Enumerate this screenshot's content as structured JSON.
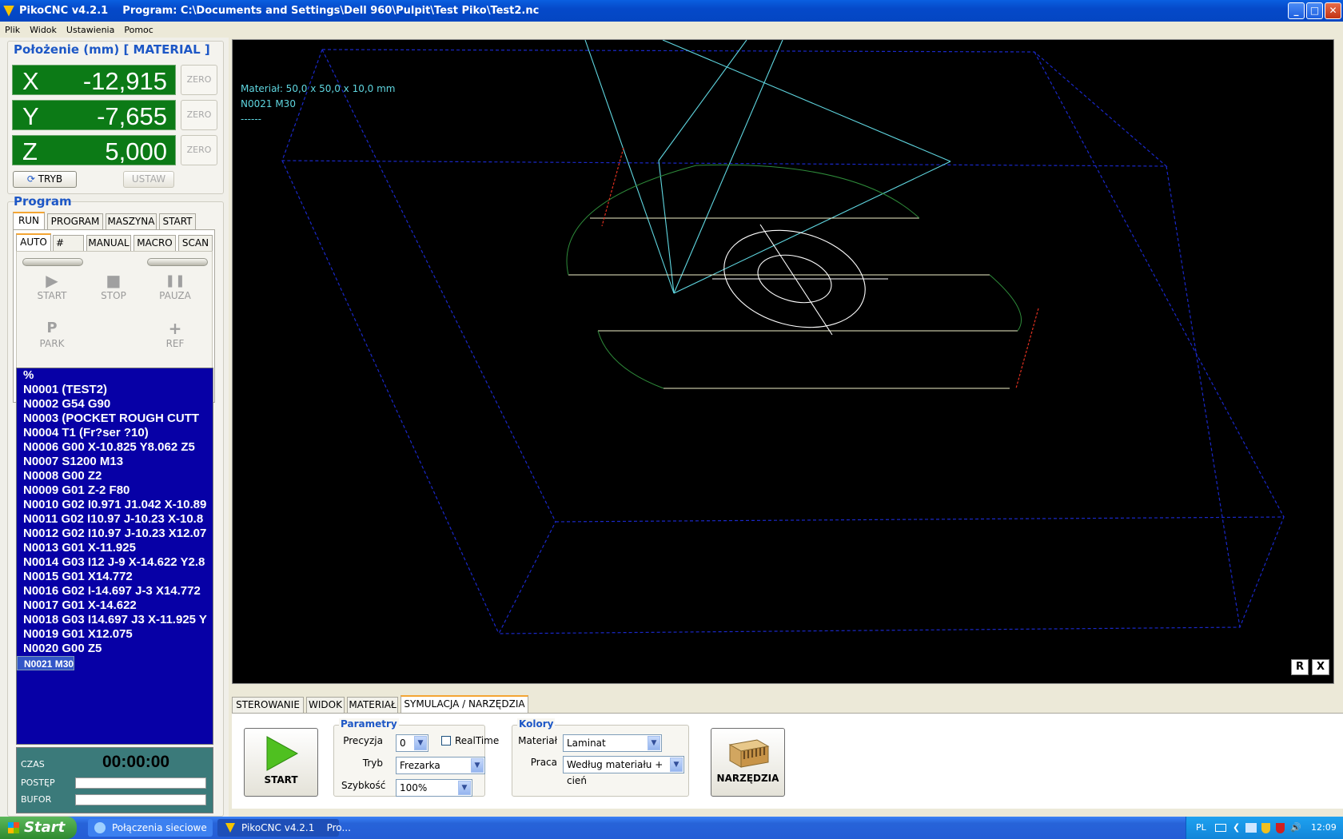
{
  "window": {
    "title": "PikoCNC v4.2.1    Program: C:\\Documents and Settings\\Dell 960\\Pulpit\\Test Piko\\Test2.nc",
    "min_glyph": "_",
    "max_glyph": "□",
    "close_glyph": "✕"
  },
  "menu": [
    "Plik",
    "Widok",
    "Ustawienia",
    "Pomoc"
  ],
  "position": {
    "title": "Położenie (mm) [ MATERIAL ]",
    "axes": [
      {
        "name": "X",
        "value": "-12,915",
        "zero": "ZERO"
      },
      {
        "name": "Y",
        "value": "-7,655",
        "zero": "ZERO"
      },
      {
        "name": "Z",
        "value": "5,000",
        "zero": "ZERO"
      }
    ],
    "mode_button": "TRYB",
    "set_button": "USTAW"
  },
  "program": {
    "title": "Program",
    "tabs": [
      "RUN",
      "PROGRAM",
      "MASZYNA",
      "START"
    ],
    "subtabs": [
      "AUTO",
      "#",
      "MANUAL",
      "MACRO",
      "SCAN"
    ],
    "controls": [
      {
        "label": "START",
        "icon": "play-icon",
        "glyph": "▶"
      },
      {
        "label": "STOP",
        "icon": "stop-icon",
        "glyph": "■"
      },
      {
        "label": "PAUZA",
        "icon": "pause-icon",
        "glyph": "❚❚"
      },
      {
        "label": "PARK",
        "icon": "park-icon",
        "glyph": "P"
      },
      {
        "label": "REF",
        "icon": "plus-icon",
        "glyph": "+"
      }
    ],
    "code_lines": [
      "%",
      "N0001 (TEST2)",
      "N0002 G54 G90",
      "N0003 (POCKET ROUGH CUTT",
      "N0004 T1 (Fr?ser ?10)",
      "N0006 G00 X-10.825 Y8.062 Z5",
      "N0007 S1200 M13",
      "N0008 G00 Z2",
      "N0009 G01 Z-2 F80",
      "N0010 G02 I0.971 J1.042 X-10.89",
      "N0011 G02 I10.97 J-10.23 X-10.8",
      "N0012 G02 I10.97 J-10.23 X12.07",
      "N0013 G01 X-11.925",
      "N0014 G03 I12 J-9 X-14.622 Y2.8",
      "N0015 G01 X14.772",
      "N0016 G02 I-14.697 J-3 X14.772",
      "N0017 G01 X-14.622",
      "N0018 G03 I14.697 J3 X-11.925 Y",
      "N0019 G01 X12.075",
      "N0020 G00 Z5",
      "N0021 M30"
    ],
    "selected_line": 20
  },
  "stats": {
    "time_label": "CZAS",
    "time_value": "00:00:00",
    "progress_label": "POSTĘP",
    "progress": 0,
    "buffer_label": "BUFOR",
    "buffer": 0
  },
  "view": {
    "info_lines": [
      "Materiał: 50,0 x 50,0 x 10,0 mm",
      "N0021 M30",
      "------"
    ],
    "r_button": "R",
    "x_button": "X",
    "colors": {
      "box": "#1a28c8",
      "rapid": "#5fd6e0",
      "cut": "#f0f0c8",
      "arc": "#2e8b3a",
      "ellipse": "#ffffff",
      "plunge": "#e03020"
    }
  },
  "bottom": {
    "tabs": [
      "STEROWANIE",
      "WIDOK",
      "MATERIAŁ",
      "SYMULACJA / NARZĘDZIA"
    ],
    "start_label": "START",
    "params_legend": "Parametry",
    "precision_label": "Precyzja",
    "precision_value": "0",
    "realtime_label": "RealTime",
    "mode_label": "Tryb",
    "mode_value": "Frezarka",
    "speed_label": "Szybkość",
    "speed_value": "100%",
    "colors_legend": "Kolory",
    "material_label": "Materiał",
    "material_value": "Laminat",
    "work_label": "Praca",
    "work_value": "Według materiału + cień",
    "tools_label": "NARZĘDZIA"
  },
  "taskbar": {
    "start": "Start",
    "tasks": [
      "Połączenia sieciowe",
      "PikoCNC v4.2.1    Pro..."
    ],
    "lang": "PL",
    "clock": "12:09"
  }
}
